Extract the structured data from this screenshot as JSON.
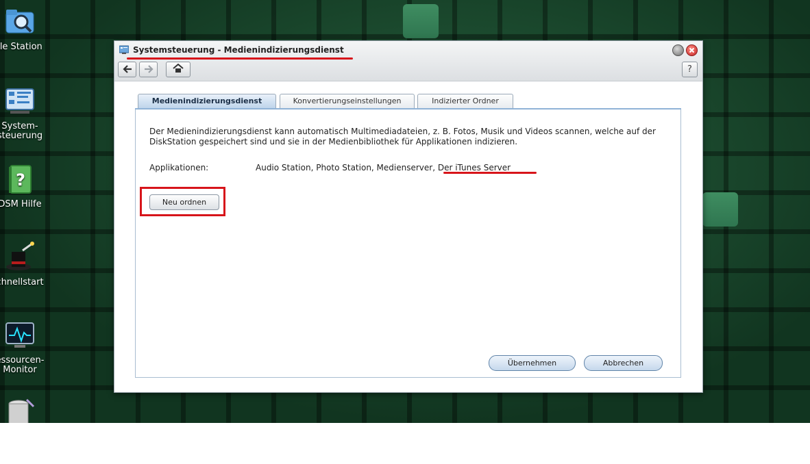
{
  "desktop": {
    "icons": [
      {
        "label": "ile Station"
      },
      {
        "label": "System-\nsteuerung"
      },
      {
        "label": "DSM Hilfe"
      },
      {
        "label": "chnellstart"
      },
      {
        "label": "essourcen-\nMonitor"
      }
    ]
  },
  "window": {
    "title": "Systemsteuerung - Medienindizierungsdienst",
    "help_label": "?",
    "tabs": [
      {
        "label": "Medienindizierungsdienst",
        "active": true
      },
      {
        "label": "Konvertierungseinstellungen",
        "active": false
      },
      {
        "label": "Indizierter Ordner",
        "active": false
      }
    ],
    "description": "Der Medienindizierungsdienst kann automatisch Multimediadateien, z. B. Fotos, Musik und Videos scannen, welche auf der DiskStation gespeichert sind und sie in der Medienbibliothek für Applikationen indizieren.",
    "applications_label": "Applikationen:",
    "applications_value": "Audio Station, Photo Station, Medienserver, Der iTunes Server",
    "reindex_button": "Neu ordnen",
    "apply_button": "Übernehmen",
    "cancel_button": "Abbrechen"
  },
  "colors": {
    "accent_red": "#d7141a",
    "tab_active": "#bcd3ea",
    "desktop_green": "#17472b"
  }
}
